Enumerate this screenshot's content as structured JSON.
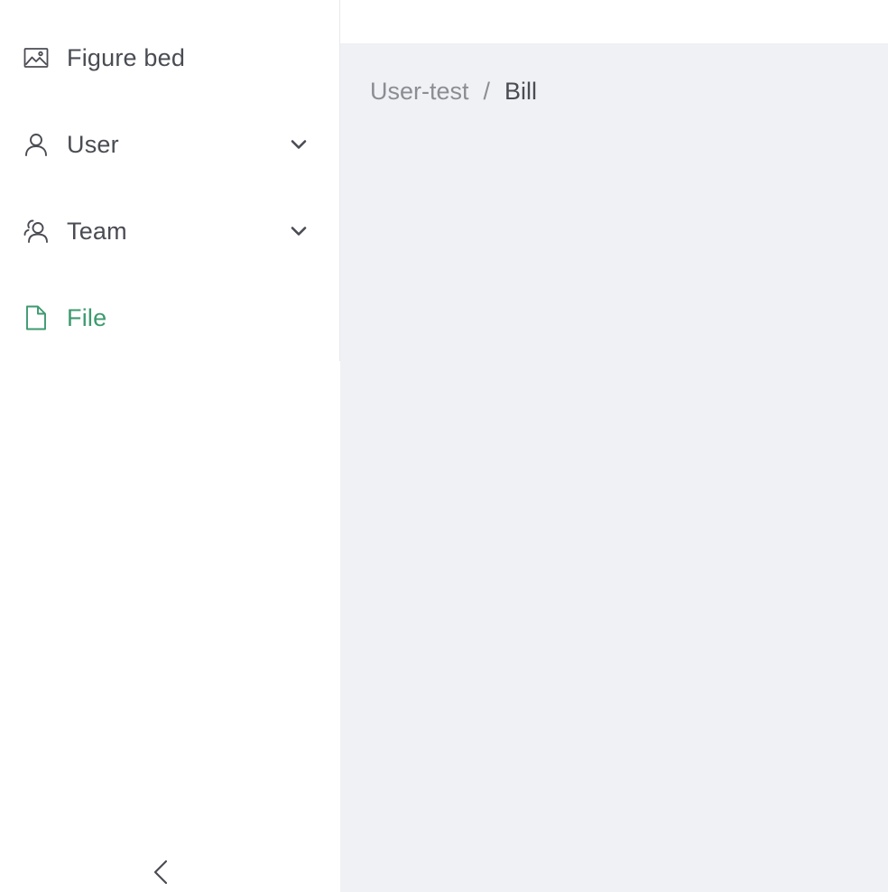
{
  "theme": {
    "accent": "#3d9a6f",
    "icon_color": "#4a4c53"
  },
  "sidebar": {
    "items": [
      {
        "label": "Figure bed",
        "icon": "image-icon",
        "expandable": false,
        "active": false
      },
      {
        "label": "User",
        "icon": "user-icon",
        "expandable": true,
        "active": false
      },
      {
        "label": "Team",
        "icon": "team-icon",
        "expandable": true,
        "active": false
      },
      {
        "label": "File",
        "icon": "file-icon",
        "expandable": false,
        "active": true
      }
    ],
    "collapse_icon": "chevron-left-icon"
  },
  "breadcrumb": {
    "parent": "User-test",
    "separator": "/",
    "current": "Bill"
  }
}
